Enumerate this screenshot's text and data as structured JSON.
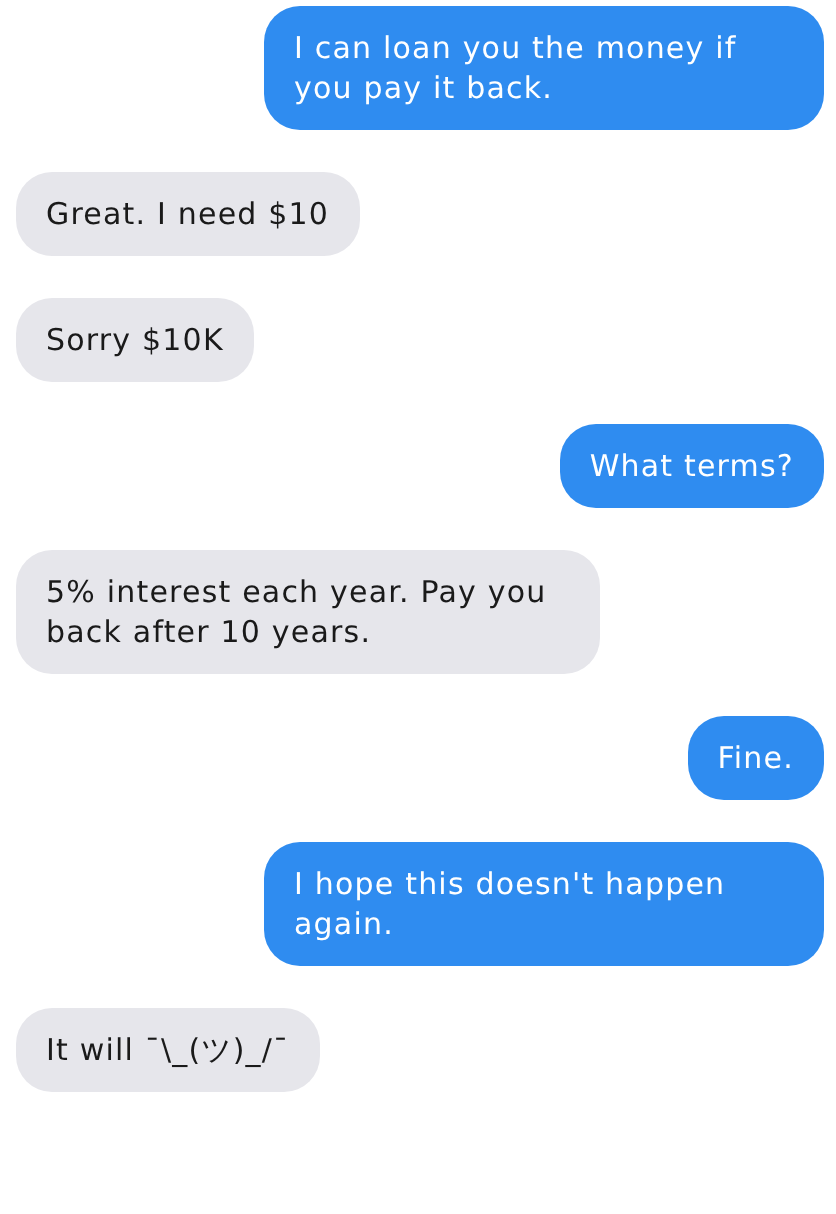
{
  "messages": [
    {
      "text": "I can loan you the money if you pay it back.",
      "kind": "sent"
    },
    {
      "text": "Great. I need $10",
      "kind": "received"
    },
    {
      "text": "Sorry $10K",
      "kind": "received"
    },
    {
      "text": "What terms?",
      "kind": "sent"
    },
    {
      "text": "5% interest each year. Pay you back after 10 years.",
      "kind": "received"
    },
    {
      "text": "Fine.",
      "kind": "sent"
    },
    {
      "text": "I hope this doesn't happen again.",
      "kind": "sent"
    },
    {
      "text": "It will ¯\\_(ツ)_/¯",
      "kind": "received"
    }
  ]
}
